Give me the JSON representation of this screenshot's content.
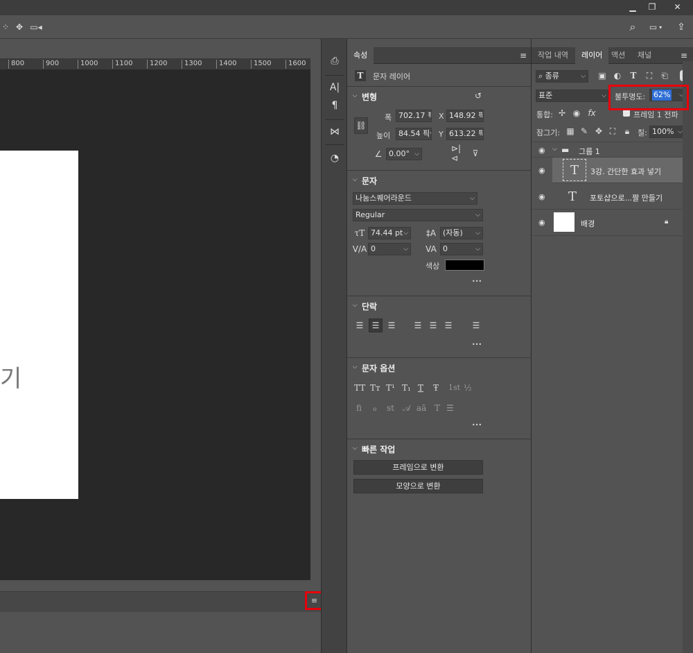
{
  "window": {
    "minimize_glyph": "▁",
    "restore_glyph": "❐",
    "close_glyph": "✕"
  },
  "options_bar": {
    "search_glyph": "⌕",
    "workspace_glyph": "▭",
    "share_glyph": "⇪",
    "collapse_left": "»",
    "collapse_right": "»"
  },
  "ruler": {
    "ticks": [
      "800",
      "900",
      "1000",
      "1100",
      "1200",
      "1300",
      "1400",
      "1500",
      "1600"
    ]
  },
  "canvas": {
    "visible_text": "기"
  },
  "toolstrip": {
    "collapse": "»"
  },
  "properties": {
    "tab": "속성",
    "layer_type": "문자 레이어",
    "transform": {
      "title": "변형",
      "width_label": "폭",
      "width": "702.17 픽",
      "height_label": "높이",
      "height": "84.54 픽셀",
      "x_label": "X",
      "x": "148.92 픽",
      "y_label": "Y",
      "y": "613.22 픽",
      "angle": "0.00°"
    },
    "character": {
      "title": "문자",
      "font": "나눔스퀘어라운드",
      "style": "Regular",
      "size": "74.44 pt",
      "leading": "(자동)",
      "kerning": "0",
      "tracking": "0",
      "color_label": "색상",
      "more": "•••"
    },
    "paragraph": {
      "title": "단락",
      "more": "•••"
    },
    "char_options": {
      "title": "문자 옵션",
      "row1": [
        "TT",
        "Tт",
        "T¹",
        "T₁",
        "T",
        "Ŧ",
        "1st",
        "½"
      ],
      "row2": [
        "fi",
        "ℴ",
        "st",
        "𝒜",
        "aā",
        "T",
        "☰"
      ],
      "more": "•••"
    },
    "quick_actions": {
      "title": "빠른 작업",
      "btn_frame": "프레임으로 변환",
      "btn_shape": "모양으로 변환"
    }
  },
  "layers_panel": {
    "tabs": [
      "작업 내역",
      "레이어",
      "액션",
      "채널"
    ],
    "filter": "종류",
    "blend_mode": "표준",
    "opacity_label": "불투명도:",
    "opacity_value": "62%",
    "unify_label": "통합:",
    "propagate_label": "프레임 1 전파",
    "lock_label": "잠그기:",
    "fill_label": "칠:",
    "fill_value": "100%",
    "layers": [
      {
        "name": "그룹 1",
        "kind": "group"
      },
      {
        "name": "3강. 간단한 효과 넣기",
        "kind": "text"
      },
      {
        "name": "포토샵으로...짤 만들기",
        "kind": "text"
      },
      {
        "name": "배경",
        "kind": "background"
      }
    ]
  },
  "colors": {
    "highlight": "#e8000b",
    "accent": "#2f6fd6",
    "text_color_swatch": "#000000"
  }
}
